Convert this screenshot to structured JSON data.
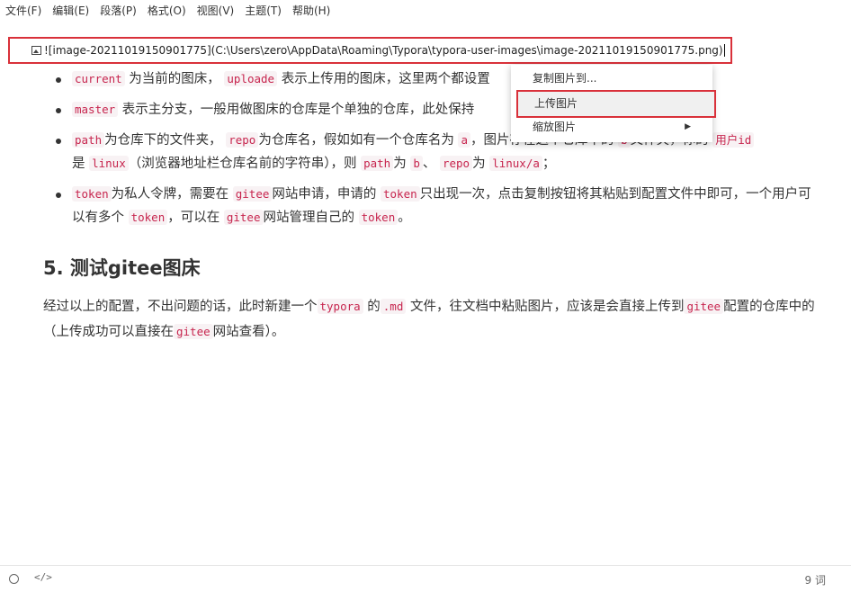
{
  "menu": [
    "文件(F)",
    "编辑(E)",
    "段落(P)",
    "格式(O)",
    "视图(V)",
    "主题(T)",
    "帮助(H)"
  ],
  "source_line": "![image-20211019150901775](C:\\Users\\zero\\AppData\\Roaming\\Typora\\typora-user-images\\image-20211019150901775.png)",
  "bullets": {
    "b1": {
      "c1": "current",
      "t1": "为当前的图床，",
      "c2": "uploade",
      "t2": "表示上传用的图床，这里两个都设置"
    },
    "b2": {
      "c1": "master",
      "t1": "表示主分支，一般用做图床的仓库是个单独的仓库，此处保持"
    },
    "b3": {
      "c1": "path",
      "t1": "为仓库下的文件夹，",
      "c2": "repo",
      "t2": "为仓库名，假如如有一个仓库名为",
      "c3": "a",
      "t3": "，图片存在这个仓库中的",
      "c4": "b",
      "t4": "文件夹，你的",
      "c5": "用户id",
      "t5": "是",
      "c6": "linux",
      "t6": "（浏览器地址栏仓库名前的字符串），则",
      "c7": "path",
      "t7": "为",
      "c8": "b",
      "t8": "、",
      "c9": "repo",
      "t9": "为",
      "c10": "linux/a",
      "t10": "；"
    },
    "b4": {
      "c1": "token",
      "t1": "为私人令牌，需要在",
      "c2": "gitee",
      "t2": "网站申请，申请的",
      "c3": "token",
      "t3": "只出现一次，点击复制按钮将其粘贴到配置文件中即可，一个用户可以有多个",
      "c4": "token",
      "t4": "，可以在",
      "c5": "gitee",
      "t5": "网站管理自己的",
      "c6": "token",
      "t6": "。"
    }
  },
  "heading": "5. 测试gitee图床",
  "paragraph": {
    "t1": "经过以上的配置，不出问题的话，此时新建一个",
    "c1": "typora",
    "t2": "的",
    "c2": ".md",
    "t3": "文件，往文档中粘贴图片，应该是会直接上传到",
    "c3": "gitee",
    "t4": "配置的仓库中的（上传成功可以直接在",
    "c4": "gitee",
    "t5": "网站查看）。"
  },
  "context_menu": {
    "copy_to": "复制图片到...",
    "upload": "上传图片",
    "zoom": "缩放图片",
    "zoom_arrow": "▶"
  },
  "footer": {
    "code_toggle": "</>",
    "word_count": "9 词"
  }
}
